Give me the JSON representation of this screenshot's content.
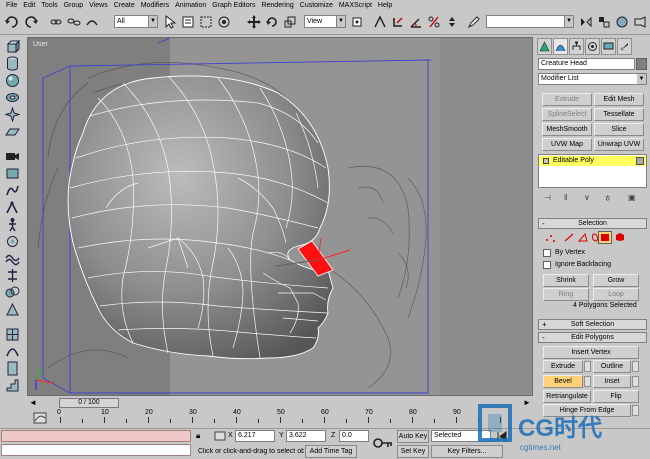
{
  "menu": [
    "File",
    "Edit",
    "Tools",
    "Group",
    "Views",
    "Create",
    "Modifiers",
    "Animation",
    "Graph Editors",
    "Rendering",
    "Customize",
    "MAXScript",
    "Help"
  ],
  "toolbar": {
    "selection_filter": "All",
    "reference_coord": "View"
  },
  "viewport": {
    "label": "User"
  },
  "command_panel": {
    "object_name": "Creature Head",
    "modifier_list": "Modifier List",
    "modifier_buttons": [
      {
        "label": "Extrude",
        "enabled": false
      },
      {
        "label": "Edit Mesh",
        "enabled": true
      },
      {
        "label": "SplineSelect",
        "enabled": false
      },
      {
        "label": "Tessellate",
        "enabled": true
      },
      {
        "label": "MeshSmooth",
        "enabled": true
      },
      {
        "label": "Slice",
        "enabled": true
      },
      {
        "label": "UVW Map",
        "enabled": true
      },
      {
        "label": "Unwrap UVW",
        "enabled": true
      }
    ],
    "stack_item": "Editable Poly",
    "selection": {
      "title": "Selection",
      "by_vertex": "By Vertex",
      "ignore_backfacing": "Ignore Backfacing",
      "shrink": "Shrink",
      "grow": "Grow",
      "ring": "Ring",
      "loop": "Loop",
      "status": "4 Polygons Selected"
    },
    "soft_selection": "Soft Selection",
    "edit_polygons": {
      "title": "Edit Polygons",
      "insert_vertex": "Insert Vertex",
      "extrude": "Extrude",
      "outline": "Outline",
      "bevel": "Bevel",
      "inset": "Inset",
      "retriangulate": "Retriangulate",
      "flip": "Flip",
      "hinge_from_edge": "Hinge From Edge"
    }
  },
  "timeline": {
    "frame": "0 / 100",
    "ticks": [
      "0",
      "10",
      "20",
      "30",
      "40",
      "50",
      "60",
      "70",
      "80",
      "90"
    ]
  },
  "status": {
    "x_label": "X",
    "x_value": "6.217",
    "y_label": "Y",
    "y_value": "3.622",
    "z_label": "Z",
    "z_value": "0.0",
    "prompt": "Click or click-and-drag to select obj",
    "add_time_tag": "Add Time Tag",
    "auto_key": "Auto Key",
    "set_key": "Set Key",
    "selected": "Selected",
    "key_filters": "Key Filters..."
  },
  "watermark": {
    "brand": "CG时代",
    "url": "cgtimes.net"
  },
  "colors": {
    "selection_red": "#ff1010",
    "wire_white": "#ffffff",
    "stack_yellow": "#ffff60",
    "bevel_active": "#ffd27a"
  }
}
